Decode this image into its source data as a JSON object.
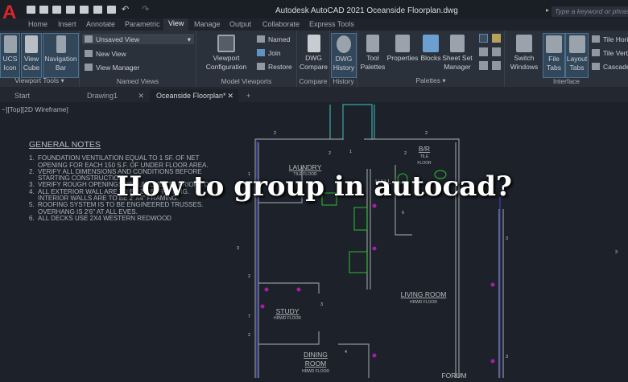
{
  "app": {
    "title": "Autodesk AutoCAD 2021   Oceanside Floorplan.dwg",
    "search_placeholder": "Type a keyword or phrase",
    "brand_color": "#d9262b"
  },
  "ribbon_tabs": [
    {
      "label": "Home"
    },
    {
      "label": "Insert"
    },
    {
      "label": "Annotate"
    },
    {
      "label": "Parametric"
    },
    {
      "label": "View",
      "active": true
    },
    {
      "label": "Manage"
    },
    {
      "label": "Output"
    },
    {
      "label": "Collaborate"
    },
    {
      "label": "Express Tools"
    }
  ],
  "panels": {
    "viewport_tools": {
      "label": "Viewport Tools",
      "ucs": "UCS Icon",
      "viewcube": "View Cube",
      "navbar": "Navigation Bar"
    },
    "named_views": {
      "label": "Named Views",
      "dropdown": "Unsaved View",
      "new_view": "New View",
      "view_manager": "View Manager"
    },
    "model_viewports": {
      "label": "Model Viewports",
      "config": "Viewport Configuration",
      "named": "Named",
      "join": "Join",
      "restore": "Restore"
    },
    "compare": {
      "label": "Compare",
      "button": "DWG Compare"
    },
    "history": {
      "label": "History",
      "button": "DWG History"
    },
    "palettes": {
      "label": "Palettes",
      "tool": "Tool Palettes",
      "properties": "Properties",
      "blocks": "Blocks",
      "sheetset": "Sheet Set Manager"
    },
    "interface": {
      "label": "Interface",
      "switch": "Switch Windows",
      "file_tabs": "File Tabs",
      "layout_tabs": "Layout Tabs",
      "tile_h": "Tile Hori",
      "tile_v": "Tile Verti",
      "cascade": "Cascade"
    }
  },
  "doc_tabs": [
    {
      "label": "Start"
    },
    {
      "label": "Drawing1"
    },
    {
      "label": "Oceanside Floorplan*",
      "active": true
    }
  ],
  "viewport_label": "−][Top][2D Wireframe]",
  "notes": {
    "title": "GENERAL NOTES",
    "items": [
      {
        "n": "1.",
        "text": "FOUNDATION VENTILATION EQUAL TO 1 SF. OF NET OPENING FOR EACH 150 S.F. OF UNDER FLOOR AREA."
      },
      {
        "n": "2.",
        "text": "VERIFY ALL DIMENSIONS AND CONDITIONS BEFORE STARTING CONSTRUCTION"
      },
      {
        "n": "3.",
        "text": "VERIFY ROUGH OPENINGS REQUIREMENTS PRIOR TO"
      },
      {
        "n": "4.",
        "text": "ALL EXTERIOR WALL ARE TO BE 2\"X6\" FRAMING. INTERIOR WALLS ARE TO BE 2\"X4\" FRAMING."
      },
      {
        "n": "5.",
        "text": "ROOFING SYSTEM IS TO BE ENGINEERED TRUSSES. OVERHANG IS 2'6\" AT ALL EVES."
      },
      {
        "n": "6.",
        "text": "ALL DECKS USE 2X4 WESTERN REDWOOD"
      }
    ]
  },
  "rooms": {
    "laundry": "LAUNDRY",
    "laundry_floor": "TILE FLOOR",
    "br": "B/R",
    "br_floor1": "TILE",
    "br_floor2": "FLOOR",
    "hall": "HALL",
    "living": "LIVING ROOM",
    "living_floor": "HRWD FLOOR",
    "study": "STUDY",
    "study_floor": "HRWD FLOOR",
    "dining1": "DINING",
    "dining2": "ROOM",
    "dining_floor": "HRWD FLOOR",
    "forum": "FORUM"
  },
  "headline": "How to group in autocad?"
}
